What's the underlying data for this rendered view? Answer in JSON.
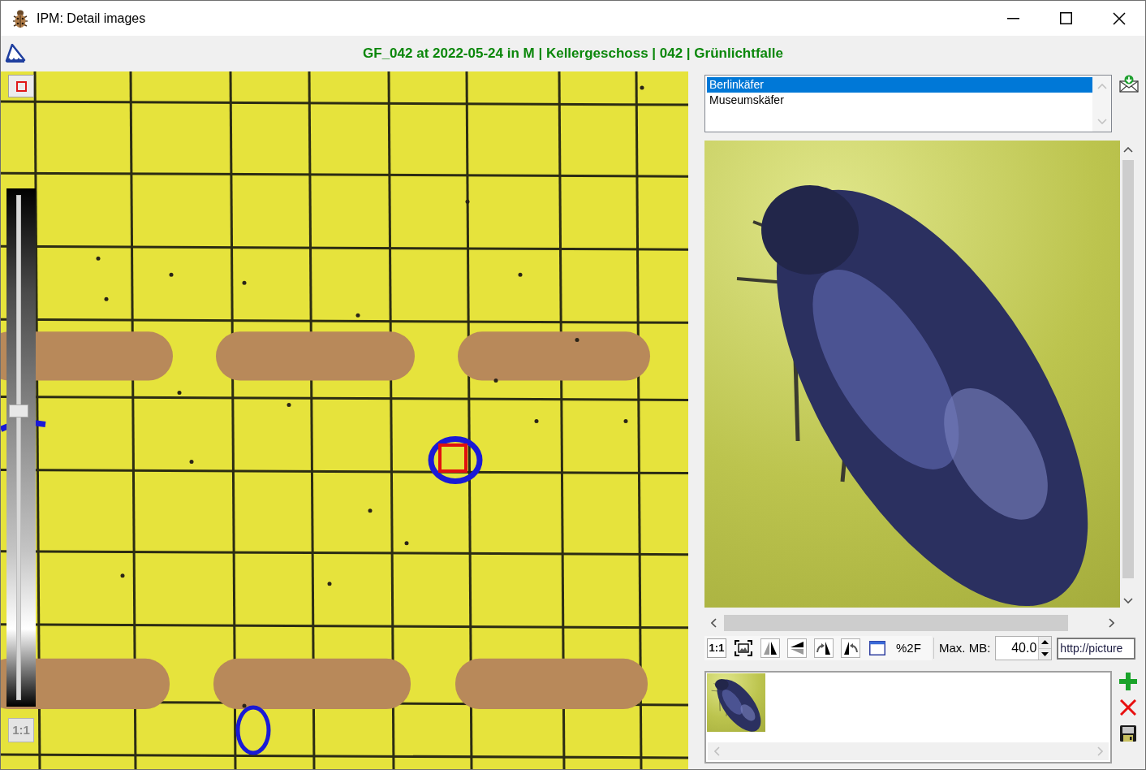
{
  "window": {
    "title": "IPM: Detail images"
  },
  "header": {
    "caption": "GF_042 at 2022-05-24 in M | Kellergeschoss | 042 | Grünlichtfalle"
  },
  "trap_view": {
    "brightness_slider": {
      "level": 0.57
    },
    "actual_size_button": "1:1"
  },
  "species_list": {
    "items": [
      {
        "label": "Berlinkäfer",
        "selected": true
      },
      {
        "label": "Museumskäfer",
        "selected": false
      }
    ]
  },
  "toolbar": {
    "actual_size_button": "1:1",
    "encode_button": "%2F",
    "max_mb": {
      "label": "Max. MB:",
      "value": "40.0"
    },
    "url_field": {
      "value": "http://picture"
    }
  }
}
